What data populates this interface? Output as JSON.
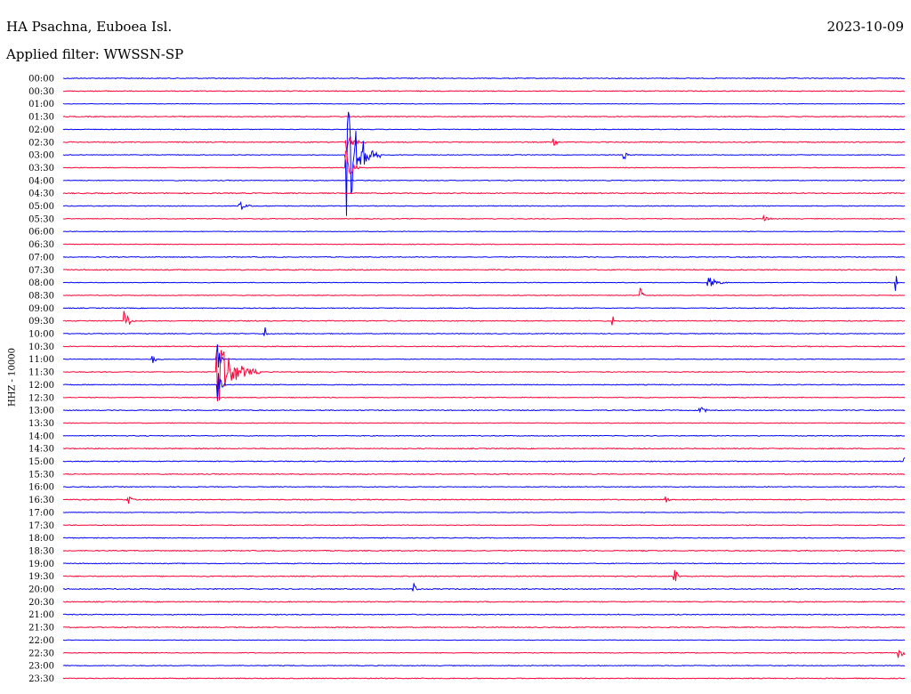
{
  "header": {
    "station": "HA Psachna, Euboea Isl.",
    "date": "2023-10-09",
    "filter_prefix": "Applied filter: ",
    "filter_name": "WWSSN-SP"
  },
  "channel_label": "HHZ - 10000",
  "colors": {
    "even_trace": "#0000ff",
    "odd_trace": "#ff0033",
    "background": "#ffffff",
    "text": "#000000"
  },
  "chart_data": {
    "type": "helicorder",
    "title": "HA Psachna, Euboea Isl.",
    "xlabel": "",
    "ylabel": "HHZ - 10000",
    "trace_minutes": 30,
    "grid": false,
    "rows": [
      "00:00",
      "00:30",
      "01:00",
      "01:30",
      "02:00",
      "02:30",
      "03:00",
      "03:30",
      "04:00",
      "04:30",
      "05:00",
      "05:30",
      "06:00",
      "06:30",
      "07:00",
      "07:30",
      "08:00",
      "08:30",
      "09:00",
      "09:30",
      "10:00",
      "10:30",
      "11:00",
      "11:30",
      "12:00",
      "12:30",
      "13:00",
      "13:30",
      "14:00",
      "14:30",
      "15:00",
      "15:30",
      "16:00",
      "16:30",
      "17:00",
      "17:30",
      "18:00",
      "18:30",
      "19:00",
      "19:30",
      "20:00",
      "20:30",
      "21:00",
      "21:30",
      "22:00",
      "22:30",
      "23:00",
      "23:30"
    ],
    "events": [
      {
        "row": "02:30",
        "minute": 10.1,
        "amplitude": 0.8,
        "duration_min": 0.8
      },
      {
        "row": "03:00",
        "minute": 10.1,
        "amplitude": 5.0,
        "duration_min": 1.2
      },
      {
        "row": "03:30",
        "minute": 10.1,
        "amplitude": 1.5,
        "duration_min": 0.5
      },
      {
        "row": "02:30",
        "minute": 17.5,
        "amplitude": 0.5,
        "duration_min": 0.3
      },
      {
        "row": "03:00",
        "minute": 20.0,
        "amplitude": 0.6,
        "duration_min": 0.2
      },
      {
        "row": "05:00",
        "minute": 6.3,
        "amplitude": 0.5,
        "duration_min": 0.5
      },
      {
        "row": "05:30",
        "minute": 25.0,
        "amplitude": 0.3,
        "duration_min": 0.5
      },
      {
        "row": "08:00",
        "minute": 23.0,
        "amplitude": 0.5,
        "duration_min": 0.8
      },
      {
        "row": "08:00",
        "minute": 29.7,
        "amplitude": 0.7,
        "duration_min": 0.1
      },
      {
        "row": "08:30",
        "minute": 20.6,
        "amplitude": 0.7,
        "duration_min": 0.2
      },
      {
        "row": "09:30",
        "minute": 2.2,
        "amplitude": 1.0,
        "duration_min": 0.4
      },
      {
        "row": "09:30",
        "minute": 19.6,
        "amplitude": 0.4,
        "duration_min": 0.1
      },
      {
        "row": "10:00",
        "minute": 7.2,
        "amplitude": 0.6,
        "duration_min": 0.2
      },
      {
        "row": "11:00",
        "minute": 3.2,
        "amplitude": 0.4,
        "duration_min": 0.6
      },
      {
        "row": "11:00",
        "minute": 5.5,
        "amplitude": 1.3,
        "duration_min": 0.3
      },
      {
        "row": "11:30",
        "minute": 5.5,
        "amplitude": 2.7,
        "duration_min": 1.5
      },
      {
        "row": "12:00",
        "minute": 5.5,
        "amplitude": 1.5,
        "duration_min": 0.3
      },
      {
        "row": "13:00",
        "minute": 22.7,
        "amplitude": 0.6,
        "duration_min": 0.4
      },
      {
        "row": "15:00",
        "minute": 30.0,
        "amplitude": 0.4,
        "duration_min": 0.6
      },
      {
        "row": "16:30",
        "minute": 2.3,
        "amplitude": 0.5,
        "duration_min": 0.3
      },
      {
        "row": "16:30",
        "minute": 21.5,
        "amplitude": 0.4,
        "duration_min": 0.3
      },
      {
        "row": "19:30",
        "minute": 21.8,
        "amplitude": 0.6,
        "duration_min": 0.3
      },
      {
        "row": "20:00",
        "minute": 12.5,
        "amplitude": 0.6,
        "duration_min": 0.3
      },
      {
        "row": "22:30",
        "minute": 29.8,
        "amplitude": 0.4,
        "duration_min": 1.2
      }
    ]
  }
}
